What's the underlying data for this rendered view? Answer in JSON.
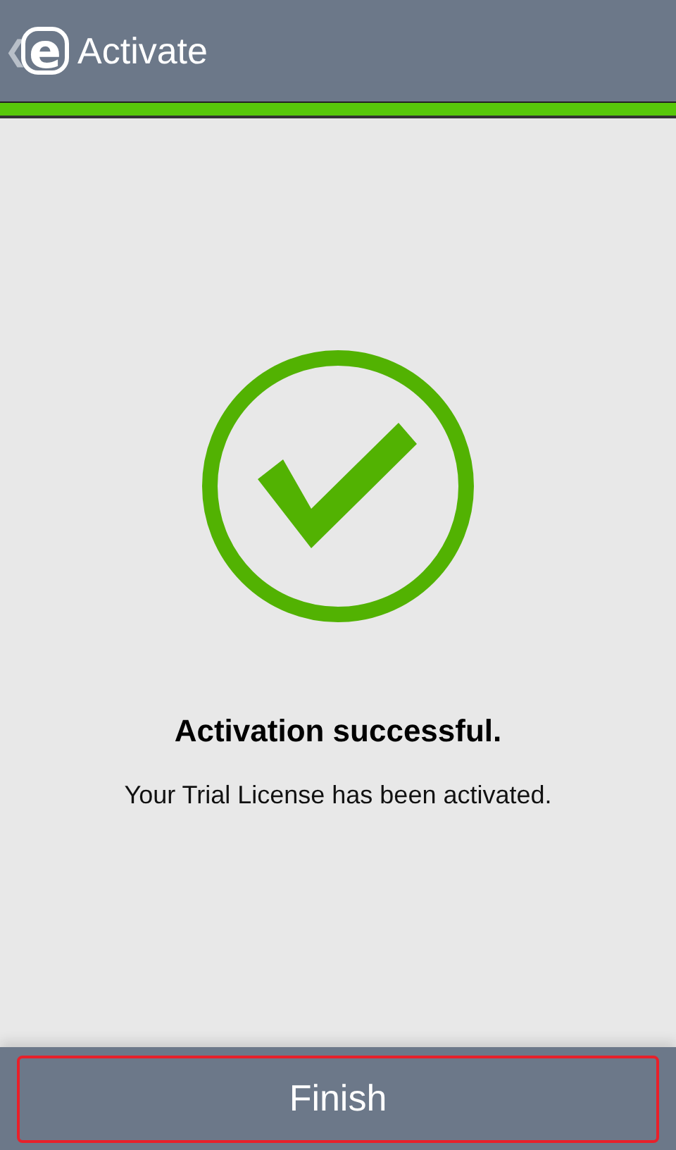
{
  "action_bar": {
    "back": "❮",
    "logo": "e",
    "title": "Activate"
  },
  "progress": {
    "level": 1
  },
  "result": {
    "title": "Activation successful.",
    "message": "Your Trial License has been activated."
  },
  "buttons": [
    {
      "label": "Finish",
      "focused": true
    }
  ]
}
